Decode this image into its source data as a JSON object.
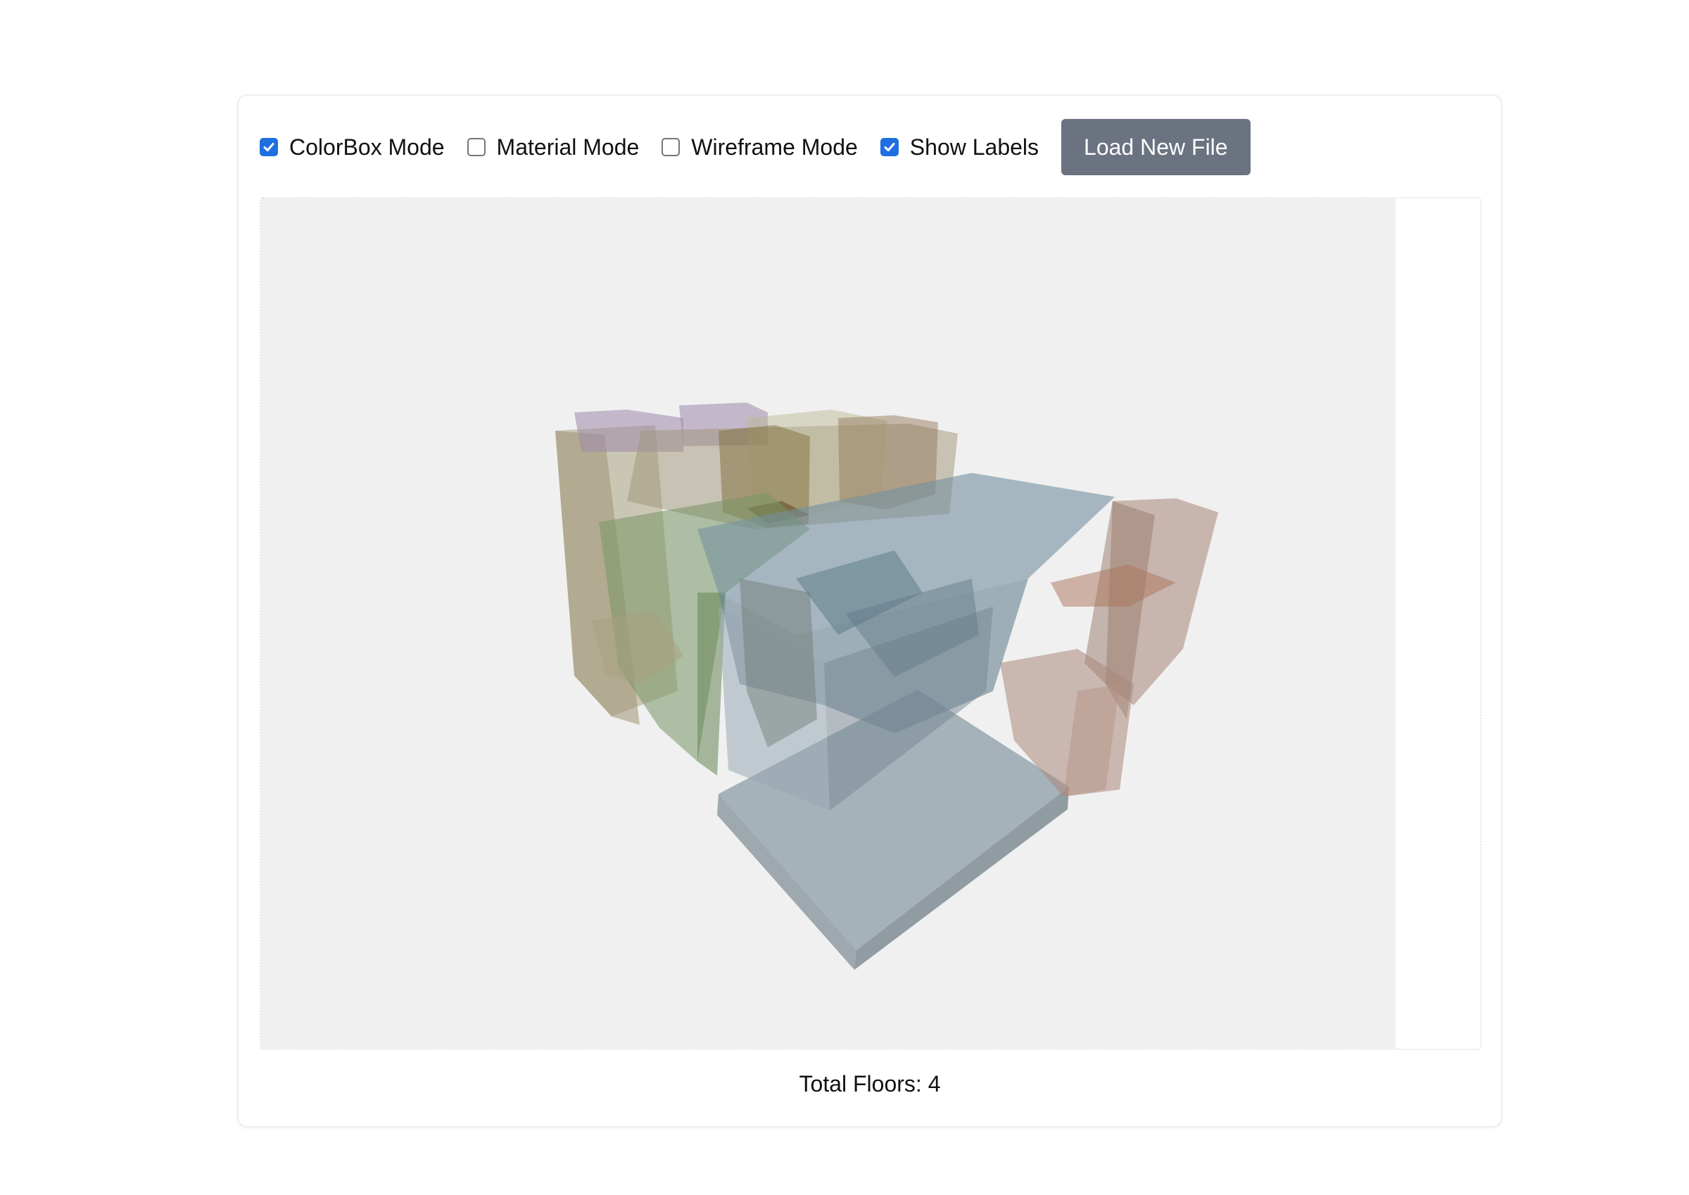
{
  "controls": {
    "options": [
      {
        "label": "ColorBox Mode",
        "checked": true
      },
      {
        "label": "Material Mode",
        "checked": false
      },
      {
        "label": "Wireframe Mode",
        "checked": false
      },
      {
        "label": "Show Labels",
        "checked": true
      }
    ],
    "load_button": "Load New File"
  },
  "footer": {
    "total_floors": "Total Floors: 4"
  },
  "colors": {
    "accent": "#1f6fe0",
    "button": "#6b7280",
    "viewport_bg": "#f0f0f0"
  }
}
